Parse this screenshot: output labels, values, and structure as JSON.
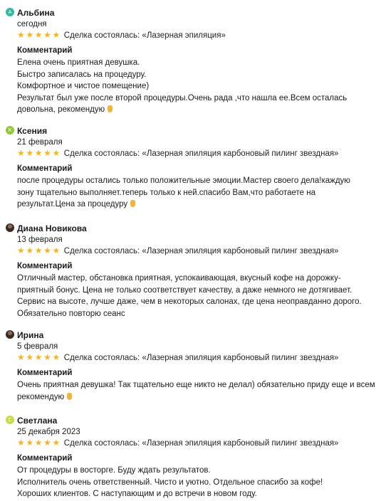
{
  "colors": {
    "star": "#f5b51e",
    "hand_emoji": "#f2b43a"
  },
  "reviews": [
    {
      "avatar_letter": "А",
      "avatar_color": "#35b7a3",
      "name": "Альбина",
      "date": "сегодня",
      "deal": "Сделка состоялась: «Лазерная эпиляция»",
      "comment_label": "Комментарий",
      "lines": [
        {
          "text": "Елена очень приятная девушка."
        },
        {
          "text": "Быстро записалась на процедуру."
        },
        {
          "text": "Комфортное и чистое помещение)"
        },
        {
          "text": "Результат был уже после второй процедуры.Очень рада ,что нашла ее.Всем осталась"
        },
        {
          "text": "довольна, рекомендую",
          "emoji": "hand-emoji-icon"
        }
      ]
    },
    {
      "avatar_letter": "К",
      "avatar_color": "#8fc93a",
      "name": "Ксения",
      "date": "21 февраля",
      "deal": "Сделка состоялась: «Лазерная эпиляция карбоновый пилинг звездная»",
      "comment_label": "Комментарий",
      "lines": [
        {
          "text": "после процедуры остались только положительные эмоции.Мастер своего дела!каждую"
        },
        {
          "text": "зону тщательно выполняет.теперь только к ней.спасибо Вам,что работаете на"
        },
        {
          "text": "результат.Цена за процедуру",
          "emoji": "hand-emoji-icon"
        }
      ]
    },
    {
      "avatar_letter": "",
      "avatar_color": "photo",
      "name": "Диана Новикова",
      "date": "13 февраля",
      "deal": "Сделка состоялась: «Лазерная эпиляция карбоновый пилинг звездная»",
      "comment_label": "Комментарий",
      "lines": [
        {
          "text": "Отличный мастер, обстановка приятная, успокаивающая, вкусный кофе на дорожку-"
        },
        {
          "text": "приятный бонус. Цена не только соответствует качеству, а даже немного не дотягивает."
        },
        {
          "text": "Сервис на высоте, лучше даже, чем в некоторых салонах, где цена неоправданно дорого."
        },
        {
          "text": "Обязательно повторю сеанс"
        }
      ]
    },
    {
      "avatar_letter": "",
      "avatar_color": "photo",
      "name": "Ирина",
      "date": "5 февраля",
      "deal": "Сделка состоялась: «Лазерная эпиляция карбоновый пилинг звездная»",
      "comment_label": "Комментарий",
      "lines": [
        {
          "text": "Очень приятная девушка! Так тщательно еще никто не делал) обязательно приду еще и всем"
        },
        {
          "text": "рекомендую",
          "emoji": "hand-emoji-icon"
        }
      ]
    },
    {
      "avatar_letter": "С",
      "avatar_color": "#c9d84a",
      "name": "Светлана",
      "date": "25 декабря 2023",
      "deal": "Сделка состоялась: «Лазерная эпиляция карбоновый пилинг звездная»",
      "comment_label": "Комментарий",
      "lines": [
        {
          "text": "От процедуры в восторге. Буду ждать результатов."
        },
        {
          "text": "Исполнитель очень ответственный. Чисто и уютно. Отдельное спасибо за кофе!"
        },
        {
          "text": "Хороших клиентов. С наступающим и до встречи в новом году."
        }
      ]
    }
  ]
}
